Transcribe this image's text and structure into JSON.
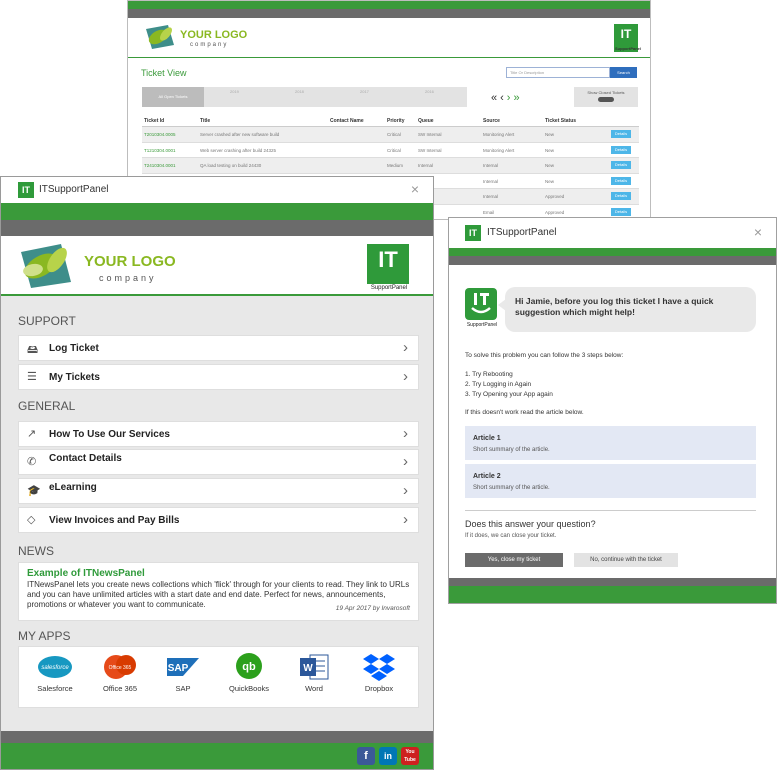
{
  "background_view": {
    "logo_text": "YOUR LOGO",
    "logo_sub": "company",
    "it_mark": "IT",
    "it_sub": "SupportPanel",
    "title": "Ticket View",
    "search_placeholder": "Title Or Description",
    "search_button": "Search",
    "filter_all": "All Open Tickets",
    "years": [
      "2019",
      "2018",
      "2017",
      "2016"
    ],
    "show_closed": "Show Closed Tickets",
    "toggle_label": "OFF",
    "columns": [
      "Ticket Id",
      "Title",
      "Contact Name",
      "Priority",
      "Queue",
      "Source",
      "Ticket Status"
    ],
    "details_label": "Details",
    "rows": [
      {
        "id": "T2010304.0005",
        "title": "Server crashed after new software build",
        "priority": "Critical",
        "queue": "SW Internal",
        "source": "Monitoring Alert",
        "status": "New"
      },
      {
        "id": "T1210304.0001",
        "title": "Web server crashing after build 24325",
        "priority": "Critical",
        "queue": "SW Internal",
        "source": "Monitoring Alert",
        "status": "New"
      },
      {
        "id": "T2410304.0001",
        "title": "QA load testing on build 24430",
        "priority": "Medium",
        "queue": "Internal",
        "source": "Internal",
        "status": "New"
      },
      {
        "id": "",
        "title": "",
        "priority": "",
        "queue": "",
        "source": "Internal",
        "status": "New"
      },
      {
        "id": "",
        "title": "",
        "priority": "",
        "queue": "",
        "source": "Internal",
        "status": "Approved"
      },
      {
        "id": "",
        "title": "",
        "priority": "",
        "queue": "",
        "source": "Email",
        "status": "Approved"
      }
    ]
  },
  "main_panel": {
    "window_title": "ITSupportPanel",
    "it_badge": "IT",
    "close": "×",
    "logo_text": "YOUR LOGO",
    "logo_sub": "company",
    "it_mark": "IT",
    "it_sub": "SupportPanel",
    "support_heading": "SUPPORT",
    "log_ticket": "Log Ticket",
    "my_tickets": "My Tickets",
    "general_heading": "GENERAL",
    "how_to_use": "How To Use Our Services",
    "contact_details": "Contact Details",
    "elearning": "eLearning",
    "invoices": "View Invoices and Pay Bills",
    "news_heading": "NEWS",
    "news_title": "Example of ITNewsPanel",
    "news_body": "ITNewsPanel lets you create news collections which 'flick' through for your clients to read. They link to URLs and you can have unlimited articles with a start date and end date. Perfect for news, announcements, promotions or whatever you want to communicate.",
    "news_date": "19 Apr 2017 by Invarosoft",
    "apps_heading": "MY APPS",
    "apps": [
      "Salesforce",
      "Office 365",
      "SAP",
      "QuickBooks",
      "Word",
      "Dropbox"
    ],
    "social": [
      "f",
      "in",
      "You Tube"
    ]
  },
  "dialog": {
    "window_title": "ITSupportPanel",
    "it_badge": "IT",
    "close": "×",
    "avatar_sub": "SupportPanel",
    "bubble": "Hi Jamie, before you log this ticket I have a quick suggestion which might help!",
    "intro": "To solve this problem you can follow the 3 steps below:",
    "steps": [
      "1. Try Rebooting",
      "2. Try Logging in Again",
      "3. Try Opening your App again"
    ],
    "fallback": "If this doesn't work read the article below.",
    "articles": [
      {
        "title": "Article 1",
        "summary": "Short summary of the article."
      },
      {
        "title": "Article 2",
        "summary": "Short summary of the article."
      }
    ],
    "question": "Does this answer your question?",
    "question_sub": "If it does, we can close your ticket.",
    "yes_button": "Yes, close my ticket",
    "no_button": "No, continue with the ticket"
  },
  "colors": {
    "brand_green": "#3a9a3a",
    "logo_green": "#8ab821",
    "grey_bar": "#6b6b6b",
    "details_blue": "#4db6e8"
  }
}
